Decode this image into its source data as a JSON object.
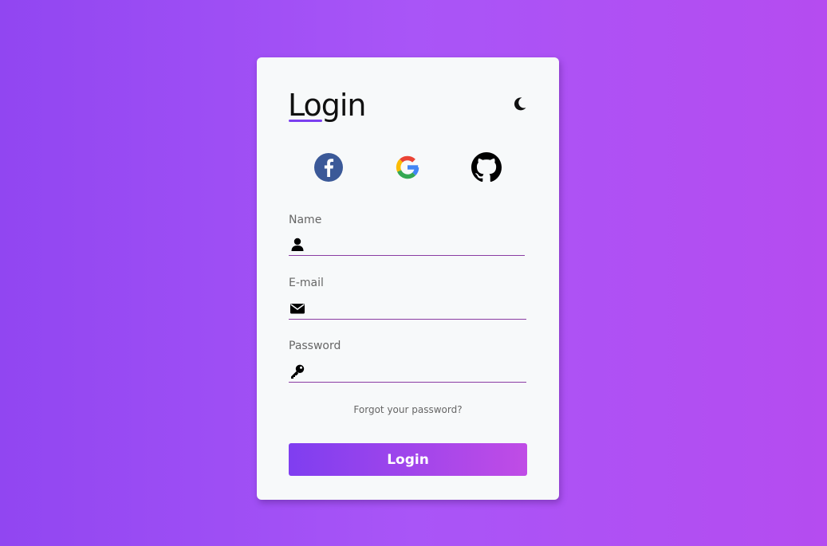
{
  "card": {
    "title": "Login"
  },
  "theme_toggle": {
    "icon": "moon-icon"
  },
  "social": [
    {
      "icon": "facebook-icon",
      "color": "#3b5998"
    },
    {
      "icon": "google-icon"
    },
    {
      "icon": "github-icon",
      "color": "#000000"
    }
  ],
  "fields": {
    "name": {
      "label": "Name",
      "icon": "user-icon",
      "value": "",
      "placeholder": ""
    },
    "email": {
      "label": "E-mail",
      "icon": "envelope-icon",
      "value": "",
      "placeholder": ""
    },
    "password": {
      "label": "Password",
      "icon": "key-icon",
      "value": "",
      "placeholder": ""
    }
  },
  "forgot_link": "Forgot your password?",
  "login_button": "Login",
  "colors": {
    "background_start": "#9146f1",
    "background_end": "#b54cf0",
    "accent": "#7b3ff0",
    "field_underline": "#8a3ca3",
    "card": "#f7f9fa"
  }
}
